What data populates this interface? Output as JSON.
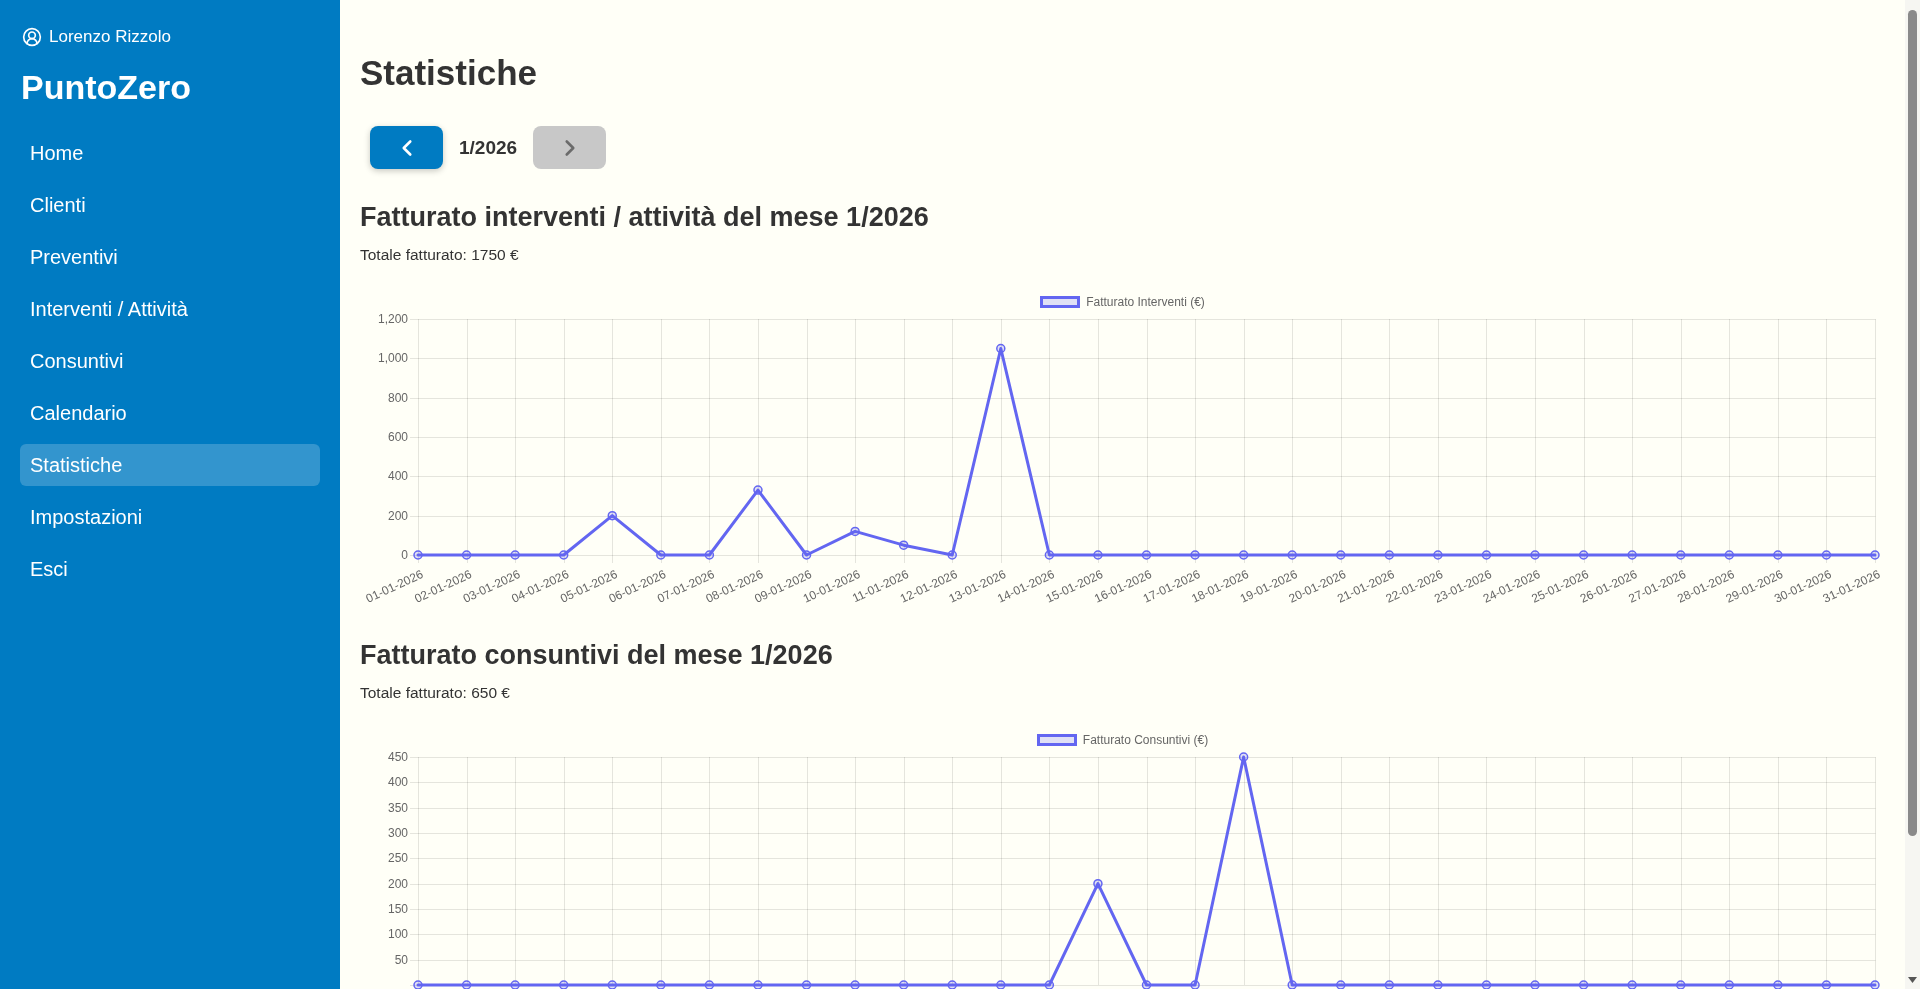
{
  "sidebar": {
    "user": "Lorenzo Rizzolo",
    "brand": "PuntoZero",
    "items": [
      {
        "label": "Home",
        "selected": false
      },
      {
        "label": "Clienti",
        "selected": false
      },
      {
        "label": "Preventivi",
        "selected": false
      },
      {
        "label": "Interventi / Attività",
        "selected": false
      },
      {
        "label": "Consuntivi",
        "selected": false
      },
      {
        "label": "Calendario",
        "selected": false
      },
      {
        "label": "Statistiche",
        "selected": true
      },
      {
        "label": "Impostazioni",
        "selected": false
      },
      {
        "label": "Esci",
        "selected": false
      }
    ]
  },
  "page": {
    "title": "Statistiche"
  },
  "month_nav": {
    "prev": {
      "disabled": false
    },
    "period": "1/2026",
    "next": {
      "disabled": true
    }
  },
  "sections": [
    {
      "title": "Fatturato interventi / attività del mese 1/2026",
      "total": "Totale fatturato: 1750 €",
      "chart_data": {
        "type": "line",
        "grid": true,
        "categories": [
          "01-01-2026",
          "02-01-2026",
          "03-01-2026",
          "04-01-2026",
          "05-01-2026",
          "06-01-2026",
          "07-01-2026",
          "08-01-2026",
          "09-01-2026",
          "10-01-2026",
          "11-01-2026",
          "12-01-2026",
          "13-01-2026",
          "14-01-2026",
          "15-01-2026",
          "16-01-2026",
          "17-01-2026",
          "18-01-2026",
          "19-01-2026",
          "20-01-2026",
          "21-01-2026",
          "22-01-2026",
          "23-01-2026",
          "24-01-2026",
          "25-01-2026",
          "26-01-2026",
          "27-01-2026",
          "28-01-2026",
          "29-01-2026",
          "30-01-2026",
          "31-01-2026"
        ],
        "series": [
          {
            "name": "Fatturato Interventi (€)",
            "color": "#6366f1",
            "marker": "circle",
            "values": [
              0,
              0,
              0,
              0,
              200,
              0,
              0,
              330,
              0,
              120,
              50,
              0,
              1050,
              0,
              0,
              0,
              0,
              0,
              0,
              0,
              0,
              0,
              0,
              0,
              0,
              0,
              0,
              0,
              0,
              0,
              0
            ]
          }
        ],
        "ylim": [
          0,
          1200
        ],
        "yticks": [
          0,
          200,
          400,
          600,
          800,
          {
            "value": 1000,
            "label": "1,000"
          },
          {
            "value": 1200,
            "label": "1,200"
          }
        ]
      }
    },
    {
      "title": "Fatturato consuntivi del mese 1/2026",
      "total": "Totale fatturato: 650 €",
      "chart_data": {
        "type": "line",
        "grid": true,
        "series": [
          {
            "name": "Fatturato Consuntivi (€)",
            "color": "#6366f1",
            "marker": "circle",
            "values": [
              0,
              0,
              0,
              0,
              0,
              0,
              0,
              0,
              0,
              0,
              0,
              0,
              0,
              0,
              200,
              0,
              0,
              450,
              0,
              0,
              0,
              0,
              0,
              0,
              0,
              0,
              0,
              0,
              0,
              0,
              0
            ]
          }
        ],
        "ylim": [
          0,
          450
        ],
        "yticks": [
          50,
          100,
          150,
          200,
          250,
          300,
          350,
          400,
          450
        ]
      }
    }
  ]
}
